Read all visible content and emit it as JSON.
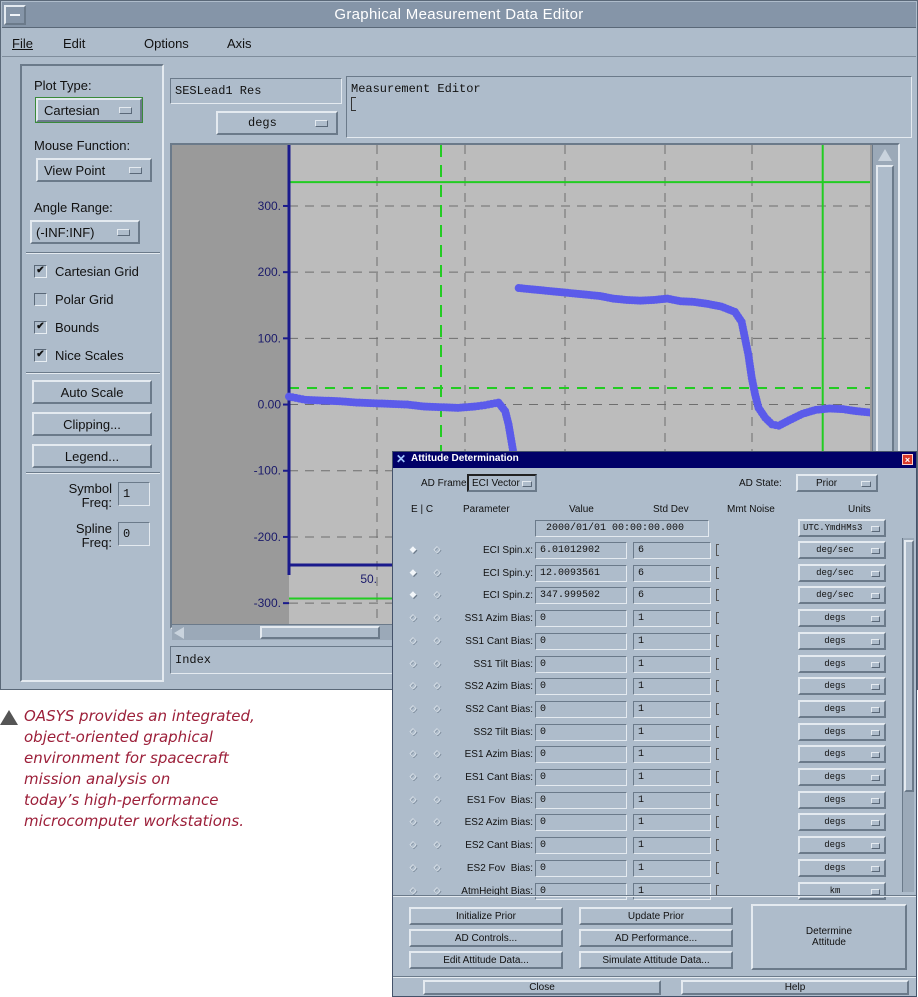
{
  "window": {
    "title": "Graphical Measurement Data Editor"
  },
  "menu": [
    {
      "label": "File"
    },
    {
      "label": "Edit"
    },
    {
      "label": "Options"
    },
    {
      "label": "Axis"
    }
  ],
  "left_panel": {
    "plot_type_label": "Plot Type:",
    "plot_type_value": "Cartesian",
    "mouse_function_label": "Mouse Function:",
    "mouse_function_value": "View Point",
    "angle_range_label": "Angle Range:",
    "angle_range_value": "(-INF:INF)",
    "checkboxes": [
      {
        "label": "Cartesian Grid",
        "checked": true
      },
      {
        "label": "Polar Grid",
        "checked": false
      },
      {
        "label": "Bounds",
        "checked": true
      },
      {
        "label": "Nice Scales",
        "checked": true
      }
    ],
    "auto_scale": "Auto Scale",
    "clipping": "Clipping...",
    "legend": "Legend...",
    "symbol_freq_label_1": "Symbol",
    "symbol_freq_label_2": "Freq:",
    "symbol_freq_value": "1",
    "spline_freq_label_1": "Spline",
    "spline_freq_label_2": "Freq:",
    "spline_freq_value": "0"
  },
  "top_fields": {
    "measurement_name": "SESLead1 Res",
    "units": "degs",
    "editor_title": "Measurement Editor"
  },
  "plot_footer": {
    "x_field": "Index"
  },
  "chart_data": {
    "type": "scatter",
    "yticks": [
      "300.",
      "200.",
      "100.",
      "0.00",
      "-100.",
      "-200.",
      "-300."
    ],
    "ytick_values": [
      300,
      200,
      100,
      0,
      -100,
      -200,
      -300
    ],
    "xtick_label": "50.",
    "ylim": [
      -330,
      380
    ],
    "xlim": [
      0,
      172
    ],
    "bounds": {
      "upper": 336,
      "lower": -293,
      "zero_line": 25
    },
    "bounds_x": [
      45,
      158
    ],
    "series": [
      {
        "points": [
          [
            0,
            12
          ],
          [
            2,
            10
          ],
          [
            5,
            7
          ],
          [
            10,
            6
          ],
          [
            15,
            5
          ],
          [
            20,
            3
          ],
          [
            25,
            2
          ],
          [
            30,
            1
          ],
          [
            35,
            0
          ],
          [
            40,
            -3
          ],
          [
            45,
            -4
          ],
          [
            50,
            -5
          ],
          [
            55,
            -3
          ],
          [
            58,
            -1
          ],
          [
            60,
            1
          ],
          [
            62,
            3
          ],
          [
            64,
            -10
          ],
          [
            65,
            -30
          ],
          [
            66,
            -60
          ],
          [
            67,
            -90
          ],
          [
            68,
            -100
          ]
        ]
      },
      {
        "points": [
          [
            68,
            176
          ],
          [
            72,
            174
          ],
          [
            76,
            172
          ],
          [
            80,
            170
          ],
          [
            84,
            168
          ],
          [
            88,
            166
          ],
          [
            92,
            164
          ],
          [
            96,
            160
          ],
          [
            100,
            158
          ],
          [
            104,
            157
          ],
          [
            108,
            158
          ],
          [
            112,
            160
          ],
          [
            116,
            156
          ],
          [
            120,
            155
          ],
          [
            124,
            152
          ],
          [
            128,
            148
          ],
          [
            132,
            140
          ],
          [
            134,
            125
          ],
          [
            135,
            100
          ],
          [
            136,
            75
          ],
          [
            137,
            40
          ],
          [
            138,
            15
          ],
          [
            139,
            -5
          ],
          [
            141,
            -20
          ],
          [
            143,
            -30
          ],
          [
            145,
            -32
          ],
          [
            148,
            -24
          ],
          [
            152,
            -14
          ],
          [
            156,
            -8
          ],
          [
            160,
            -6
          ],
          [
            164,
            -7
          ],
          [
            168,
            -10
          ],
          [
            172,
            -12
          ]
        ]
      }
    ]
  },
  "caption": {
    "lines": [
      "OASYS provides an integrated,",
      "object-oriented graphical",
      "environment for spacecraft",
      "mission analysis on",
      "today’s high-performance",
      "microcomputer workstations."
    ]
  },
  "ad": {
    "title": "Attitude Determination",
    "frame_label": "AD Frame:",
    "frame_value": "ECI Vector",
    "state_label": "AD State:",
    "state_value": "Prior",
    "headers": {
      "ec": "E | C",
      "parameter": "Parameter",
      "value": "Value",
      "std": "Std Dev",
      "noise": "Mmt Noise",
      "units": "Units"
    },
    "epoch": {
      "value": "2000/01/01 00:00:00.000",
      "units": "UTC.YmdHMs3"
    },
    "rows": [
      {
        "param": "ECI Spin.x:",
        "value": "6.01012902",
        "std": "6",
        "units": "deg/sec"
      },
      {
        "param": "ECI Spin.y:",
        "value": "12.0093561",
        "std": "6",
        "units": "deg/sec"
      },
      {
        "param": "ECI Spin.z:",
        "value": "347.999502",
        "std": "6",
        "units": "deg/sec"
      },
      {
        "param": "SS1 Azim Bias:",
        "value": "0",
        "std": "1",
        "units": "degs"
      },
      {
        "param": "SS1 Cant Bias:",
        "value": "0",
        "std": "1",
        "units": "degs"
      },
      {
        "param": "SS1 Tilt Bias:",
        "value": "0",
        "std": "1",
        "units": "degs"
      },
      {
        "param": "SS2 Azim Bias:",
        "value": "0",
        "std": "1",
        "units": "degs"
      },
      {
        "param": "SS2 Cant Bias:",
        "value": "0",
        "std": "1",
        "units": "degs"
      },
      {
        "param": "SS2 Tilt Bias:",
        "value": "0",
        "std": "1",
        "units": "degs"
      },
      {
        "param": "ES1 Azim Bias:",
        "value": "0",
        "std": "1",
        "units": "degs"
      },
      {
        "param": "ES1 Cant Bias:",
        "value": "0",
        "std": "1",
        "units": "degs"
      },
      {
        "param": "ES1 Fov  Bias:",
        "value": "0",
        "std": "1",
        "units": "degs"
      },
      {
        "param": "ES2 Azim Bias:",
        "value": "0",
        "std": "1",
        "units": "degs"
      },
      {
        "param": "ES2 Cant Bias:",
        "value": "0",
        "std": "1",
        "units": "degs"
      },
      {
        "param": "ES2 Fov  Bias:",
        "value": "0",
        "std": "1",
        "units": "degs"
      },
      {
        "param": "AtmHeight Bias:",
        "value": "0",
        "std": "1",
        "units": "km"
      }
    ],
    "buttons": {
      "initialize_prior": "Initialize Prior",
      "update_prior": "Update Prior",
      "ad_controls": "AD Controls...",
      "ad_performance": "AD Performance...",
      "edit_attitude": "Edit Attitude Data...",
      "simulate_attitude": "Simulate Attitude Data...",
      "determine_1": "Determine",
      "determine_2": "Attitude",
      "close": "Close",
      "help": "Help"
    }
  },
  "colors": {
    "plot_bg": "#bcbcbc",
    "marker": "#5b5bea",
    "axis": "#1a1a8c",
    "bounds": "#22cc22",
    "caption": "#9c1f39",
    "ad_title_bar": "#000068",
    "motif": "#aebccb"
  }
}
